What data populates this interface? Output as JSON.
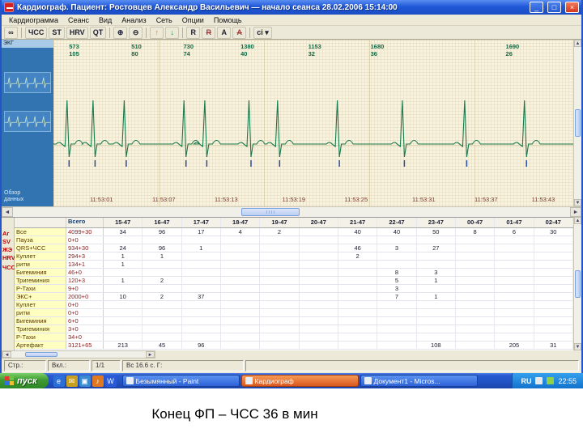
{
  "caption": "Конец ФП – ЧСС 36 в мин",
  "window": {
    "title": "Кардиограф. Пациент: Ростовцев Александр Васильевич — начало сеанса 28.02.2006 15:14:00",
    "menu": [
      "Кардиограмма",
      "Сеанс",
      "Вид",
      "Анализ",
      "Сеть",
      "Опции",
      "Помощь"
    ],
    "toolbar": [
      {
        "name": "search",
        "glyph": "∞"
      },
      {
        "name": "hr",
        "glyph": "ЧСС"
      },
      {
        "name": "st",
        "glyph": "ST"
      },
      {
        "name": "hrv",
        "glyph": "HRV"
      },
      {
        "name": "qt",
        "glyph": "QT"
      },
      {
        "name": "zoom-in",
        "glyph": "⊕"
      },
      {
        "name": "zoom-out",
        "glyph": "⊖"
      },
      {
        "name": "marker-up",
        "glyph": "↑"
      },
      {
        "name": "marker-down",
        "glyph": "↓"
      },
      {
        "name": "r-show",
        "glyph": "R"
      },
      {
        "name": "r-hide",
        "glyph": "R",
        "strike": true
      },
      {
        "name": "a-show",
        "glyph": "A"
      },
      {
        "name": "a-hide",
        "glyph": "A",
        "strike": true
      },
      {
        "name": "ci",
        "glyph": "ci ▾"
      }
    ],
    "controls": {
      "minimize": "_",
      "maximize": "□",
      "close": "×"
    }
  },
  "sidebar": {
    "header": "ЭКГ",
    "footer_lines": [
      "Обзор",
      "данных"
    ]
  },
  "ecg": {
    "annotations": [
      {
        "interval": "573",
        "rate": "105",
        "x_pct": 3
      },
      {
        "interval": "510",
        "rate": "80",
        "x_pct": 15
      },
      {
        "interval": "730",
        "rate": "74",
        "x_pct": 25
      },
      {
        "interval": "1380",
        "rate": "40",
        "x_pct": 36
      },
      {
        "interval": "1153",
        "rate": "32",
        "x_pct": 49
      },
      {
        "interval": "1680",
        "rate": "36",
        "x_pct": 61
      },
      {
        "interval": "1690",
        "rate": "26",
        "x_pct": 87
      }
    ],
    "time_labels": [
      {
        "t": "11:53:01",
        "x_pct": 7
      },
      {
        "t": "11:53:07",
        "x_pct": 19
      },
      {
        "t": "11:53:13",
        "x_pct": 31
      },
      {
        "t": "11:53:19",
        "x_pct": 44
      },
      {
        "t": "11:53:25",
        "x_pct": 56
      },
      {
        "t": "11:53:31",
        "x_pct": 69
      },
      {
        "t": "11:53:37",
        "x_pct": 81
      },
      {
        "t": "11:53:43",
        "x_pct": 92
      }
    ],
    "beats_x_pct": [
      3,
      8,
      14,
      25.5,
      29.5,
      38,
      43.5,
      55,
      67.5,
      79.5,
      91
    ],
    "trace_color": "#177a4e",
    "marker_color": "#2a4aa8"
  },
  "table": {
    "section_labels": [
      "Аг",
      "SV",
      "ЖЭ",
      "HRV",
      "ЧСС"
    ],
    "total_header": "Всего",
    "col_headers": [
      "15-47",
      "16-47",
      "17-47",
      "18-47",
      "19-47",
      "20-47",
      "21-47",
      "22-47",
      "23-47",
      "00-47",
      "01-47",
      "02-47"
    ],
    "rows": [
      {
        "label": "Все",
        "total": "4099+30",
        "cells": [
          "34",
          "96",
          "17",
          "4",
          "2",
          "",
          "40",
          "40",
          "50",
          "8",
          "6",
          "30"
        ]
      },
      {
        "label": "Пауза",
        "total": "0+0",
        "cells": [
          "",
          "",
          "",
          "",
          "",
          "",
          "",
          "",
          "",
          "",
          "",
          ""
        ]
      },
      {
        "label": "QRS+ЧСС",
        "total": "934+30",
        "cells": [
          "24",
          "96",
          "1",
          "",
          "",
          "",
          "46",
          "3",
          "27",
          "",
          "",
          ""
        ]
      },
      {
        "label": "Куплет",
        "total": "294+3",
        "cells": [
          "1",
          "1",
          "",
          "",
          "",
          "",
          "2",
          "",
          "",
          "",
          "",
          ""
        ]
      },
      {
        "label": "ритм",
        "total": "134+1",
        "cells": [
          "1",
          "",
          "",
          "",
          "",
          "",
          "",
          "",
          "",
          "",
          "",
          ""
        ]
      },
      {
        "label": "Бигеминия",
        "total": "46+0",
        "cells": [
          "",
          "",
          "",
          "",
          "",
          "",
          "",
          "8",
          "3",
          "",
          "",
          ""
        ]
      },
      {
        "label": "Тригеминия",
        "total": "120+3",
        "cells": [
          "1",
          "2",
          "",
          "",
          "",
          "",
          "",
          "5",
          "1",
          "",
          "",
          ""
        ]
      },
      {
        "label": "Р-Тахи",
        "total": "9+0",
        "cells": [
          "",
          "",
          "",
          "",
          "",
          "",
          "",
          "3",
          "",
          "",
          "",
          ""
        ]
      },
      {
        "label": "ЭКС+",
        "total": "2000+0",
        "cells": [
          "10",
          "2",
          "37",
          "",
          "",
          "",
          "",
          "7",
          "1",
          "",
          "",
          ""
        ]
      },
      {
        "label": "Куплет",
        "total": "0+0",
        "cells": [
          "",
          "",
          "",
          "",
          "",
          "",
          "",
          "",
          "",
          "",
          "",
          ""
        ]
      },
      {
        "label": "ритм",
        "total": "0+0",
        "cells": [
          "",
          "",
          "",
          "",
          "",
          "",
          "",
          "",
          "",
          "",
          "",
          ""
        ]
      },
      {
        "label": "Бигеминия",
        "total": "6+0",
        "cells": [
          "",
          "",
          "",
          "",
          "",
          "",
          "",
          "",
          "",
          "",
          "",
          ""
        ]
      },
      {
        "label": "Тригеминия",
        "total": "3+0",
        "cells": [
          "",
          "",
          "",
          "",
          "",
          "",
          "",
          "",
          "",
          "",
          "",
          ""
        ]
      },
      {
        "label": "Р-Тахи",
        "total": "34+0",
        "cells": [
          "",
          "",
          "",
          "",
          "",
          "",
          "",
          "",
          "",
          "",
          "",
          ""
        ]
      },
      {
        "label": "Артефакт",
        "total": "3121+65",
        "cells": [
          "213",
          "45",
          "96",
          "",
          "",
          "",
          "",
          "",
          "108",
          "",
          "205",
          "31"
        ]
      }
    ]
  },
  "status": {
    "p1": "Стр.:",
    "p2": "Вкл.:",
    "p3": "1/1",
    "p4": "Вс 16.6 с. Г:"
  },
  "taskbar": {
    "start": "пуск",
    "quick_launch": [
      {
        "name": "internet-explorer",
        "glyph": "e",
        "color": "#2a6fd8"
      },
      {
        "name": "mail",
        "glyph": "✉",
        "color": "#c8a020"
      },
      {
        "name": "show-desktop",
        "glyph": "▣",
        "color": "#3a8ad0"
      },
      {
        "name": "media-player",
        "glyph": "♪",
        "color": "#e07820"
      },
      {
        "name": "word",
        "glyph": "W",
        "color": "#2a5ad8"
      }
    ],
    "tasks": [
      {
        "label": "Безымянный - Paint",
        "alert": false
      },
      {
        "label": "Кардиограф",
        "alert": true
      },
      {
        "label": "Документ1 - Micros...",
        "alert": false
      }
    ],
    "lang": "RU",
    "time": "22:55"
  }
}
